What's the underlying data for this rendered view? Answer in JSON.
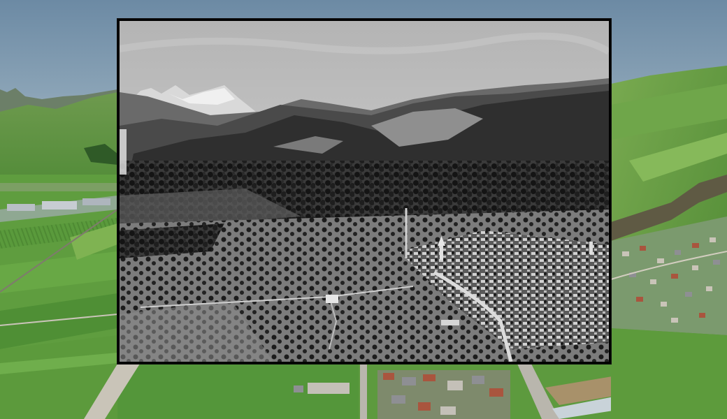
{
  "scene": {
    "description_name": "3d-terrain-view",
    "colors": {
      "sky": "#7f98ac",
      "meadow": "#5f9d3f",
      "meadow_light": "#7fb352",
      "field_dark": "#3f6b2c",
      "road": "#c9c4b8",
      "roof_red": "#a9553e",
      "roof_grey": "#8e8f93"
    }
  },
  "overlay_photo": {
    "style": "black-and-white aerial photograph",
    "colors": {
      "sky_top": "#b9b9b9",
      "sky_bottom": "#d6d6d6",
      "snow": "#e8e8e8",
      "far_mountains": "#6a6a6a",
      "mid_mountains": "#3b3b3b",
      "trees": "#1d1d1d",
      "meadow": "#8a8a8a",
      "road": "#d9d9d9"
    }
  }
}
